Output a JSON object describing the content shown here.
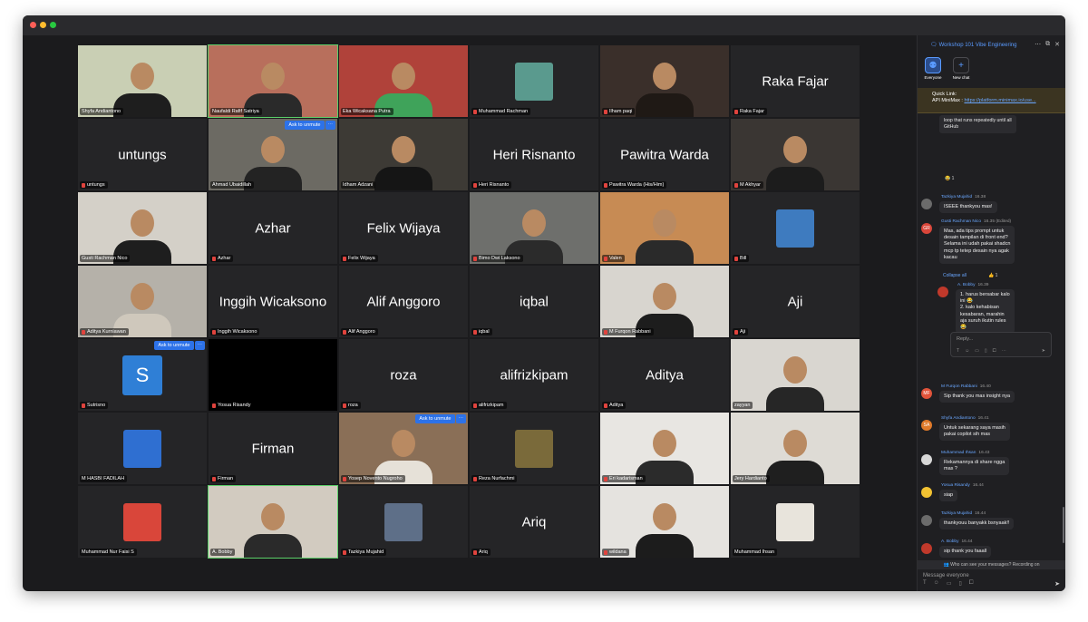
{
  "window": {
    "title": "Workshop 101 Vibe Engineering"
  },
  "chat": {
    "title": "Workshop 101 Vibe Engineering",
    "tabs": [
      {
        "label": "Everyone"
      },
      {
        "label": "New chat"
      }
    ],
    "pinned": {
      "heading": "Quick Link:",
      "text": "API MiniMax : ",
      "link": "https://platform.minimax.io/use..."
    },
    "top_quote": [
      "loop that runs repeatedly until all",
      "GitHub"
    ],
    "top_reaction": "😂 1",
    "messages": [
      {
        "name": "Tazkiya Mujahid",
        "time": "16.38",
        "lines": [
          "ISEEE thankyou mas!"
        ],
        "initials": "",
        "color": "#6b6b6b"
      },
      {
        "name": "Gusti Rachman Nico",
        "time": "16.35 (Edited)",
        "lines": [
          "Mas, ada tips prompt untuk",
          "desain tampilan di front end?",
          "Selama ini udah pakai shadcn",
          "mcp tp tetep desain nya agak",
          "kacau"
        ],
        "initials": "GR",
        "color": "#d9463a"
      },
      {
        "name": "A. Bobby",
        "time": "16.39",
        "lines": [
          "1. harus bersabar kalo",
          "ini 😂",
          "2. kalo kehabisan",
          "kesabaran, marahin",
          "aja suruh ikutin rules",
          "😂"
        ],
        "initials": "",
        "color": "#c0392b"
      },
      {
        "name": "M Furqon Rabbani",
        "time": "16.40",
        "lines": [
          "Sip thank you mas insight nya"
        ],
        "initials": "MF",
        "color": "#e0533a"
      },
      {
        "name": "Shyfa Andiantono",
        "time": "16.41",
        "lines": [
          "Untuk sekarang saya masih",
          "pakai copilot sih mas"
        ],
        "initials": "SA",
        "color": "#e07a2a"
      },
      {
        "name": "Muhammad Ihsan",
        "time": "16.43",
        "lines": [
          "Rekamannya di share ngga",
          "mas ?"
        ],
        "initials": "",
        "color": "#d8d8d8"
      },
      {
        "name": "Yosua Risandy",
        "time": "16.44",
        "lines": [
          "siap"
        ],
        "initials": "",
        "color": "#f2c232"
      },
      {
        "name": "Tazkiya Mujahid",
        "time": "16.44",
        "lines": [
          "thankyouu banyakk bsnyaak!!"
        ],
        "initials": "",
        "color": "#6b6b6b"
      },
      {
        "name": "A. Bobby",
        "time": "16.44",
        "lines": [
          "sip thank you faaall"
        ],
        "initials": "",
        "color": "#c0392b"
      }
    ],
    "collapse_label": "Collapse all",
    "collapse_react": "👍 1",
    "reply_placeholder": "Reply...",
    "notice": "Who can see your messages? Recording on",
    "compose_placeholder": "Message everyone"
  },
  "tiles": [
    {
      "label": "Shyfa Andiantono",
      "bigname": "",
      "kind": "photo",
      "bg": "#c9cfb4",
      "body": "#1e1e1e",
      "muted": false
    },
    {
      "label": "Naufaldi Rafif Satriya",
      "bigname": "",
      "kind": "photo",
      "bg": "#b86f5c",
      "body": "#2a2a2a",
      "muted": false,
      "active": true
    },
    {
      "label": "Eka Wicaksana Putra",
      "bigname": "",
      "kind": "photo",
      "bg": "#b0423a",
      "body": "#3fa35a",
      "muted": false
    },
    {
      "label": "Muhammad Rachman",
      "bigname": "",
      "kind": "avatar",
      "bg": "#252527",
      "avatar": "#5a9a8e",
      "muted": true
    },
    {
      "label": "Ilham paqi",
      "bigname": "",
      "kind": "photo",
      "bg": "#3a2f2a",
      "body": "#1f1915",
      "muted": true
    },
    {
      "label": "Raka Fajar",
      "bigname": "Raka Fajar",
      "kind": "name",
      "muted": true
    },
    {
      "label": "untungs",
      "bigname": "untungs",
      "kind": "name",
      "muted": true
    },
    {
      "label": "Ahmad Ubaidillah",
      "bigname": "",
      "kind": "photo",
      "bg": "#6c6a63",
      "body": "#232323",
      "muted": false,
      "ask": "Ask to unmute"
    },
    {
      "label": "Idham Adzani",
      "bigname": "",
      "kind": "photo",
      "bg": "#3d3a35",
      "body": "#151515",
      "muted": false
    },
    {
      "label": "Heri Risnanto",
      "bigname": "Heri Risnanto",
      "kind": "name",
      "muted": true
    },
    {
      "label": "Pawitra Warda (His/Him)",
      "bigname": "Pawitra Warda",
      "kind": "name",
      "muted": true
    },
    {
      "label": "M Akhyar",
      "bigname": "",
      "kind": "photo",
      "bg": "#3a3633",
      "body": "#1c1c1c",
      "muted": true
    },
    {
      "label": "Gusti Rachman Nico",
      "bigname": "",
      "kind": "photo",
      "bg": "#d4d0c8",
      "body": "#1e1e1e",
      "muted": false
    },
    {
      "label": "Azhar",
      "bigname": "Azhar",
      "kind": "name",
      "muted": true
    },
    {
      "label": "Felix Wijaya",
      "bigname": "Felix Wijaya",
      "kind": "name",
      "muted": true
    },
    {
      "label": "Bimo Dwi Laksono",
      "bigname": "",
      "kind": "photo",
      "bg": "#6e6f6c",
      "body": "#2b2b2b",
      "muted": true
    },
    {
      "label": "Valen",
      "bigname": "",
      "kind": "photo",
      "bg": "#c78b54",
      "body": "#2a2a2a",
      "muted": true
    },
    {
      "label": "Bill",
      "bigname": "",
      "kind": "avatar",
      "bg": "#252527",
      "avatar": "#3e7bbf",
      "muted": true
    },
    {
      "label": "Aditya Kurniawan",
      "bigname": "",
      "kind": "photo",
      "bg": "#b5b1a9",
      "body": "#cfc8bc",
      "muted": true
    },
    {
      "label": "Inggih Wicaksono",
      "bigname": "Inggih Wicaksono",
      "kind": "name",
      "muted": true
    },
    {
      "label": "Alif Anggoro",
      "bigname": "Alif Anggoro",
      "kind": "name",
      "muted": true
    },
    {
      "label": "iqbal",
      "bigname": "iqbal",
      "kind": "name",
      "muted": true
    },
    {
      "label": "M Furqon Rabbani",
      "bigname": "",
      "kind": "photo",
      "bg": "#d8d5cf",
      "body": "#1d1d1d",
      "muted": true
    },
    {
      "label": "Aji",
      "bigname": "Aji",
      "kind": "name",
      "muted": true
    },
    {
      "label": "Sutrisno",
      "bigname": "",
      "kind": "letter",
      "letter": "S",
      "muted": true,
      "ask": "Ask to unmute"
    },
    {
      "label": "Yosua Risandy",
      "bigname": "",
      "kind": "black",
      "muted": true
    },
    {
      "label": "roza",
      "bigname": "roza",
      "kind": "name",
      "muted": true
    },
    {
      "label": "alifrizkipam",
      "bigname": "alifrizkipam",
      "kind": "name",
      "muted": true
    },
    {
      "label": "Aditya",
      "bigname": "Aditya",
      "kind": "name",
      "muted": true
    },
    {
      "label": "zayyan",
      "bigname": "",
      "kind": "photo",
      "bg": "#d9d6d0",
      "body": "#262626",
      "muted": false
    },
    {
      "label": "M HASBI FADILAH",
      "bigname": "",
      "kind": "avatar",
      "bg": "#252527",
      "avatar": "#2f6fd1",
      "muted": false
    },
    {
      "label": "Firman",
      "bigname": "Firman",
      "kind": "name",
      "muted": true
    },
    {
      "label": "Yosep Novento Nugroho",
      "bigname": "",
      "kind": "photo",
      "bg": "#8a6f57",
      "body": "#e6e1d8",
      "muted": true,
      "ask": "Ask to unmute"
    },
    {
      "label": "Reza Nurfachmi",
      "bigname": "",
      "kind": "avatar",
      "bg": "#252527",
      "avatar": "#7a6a3a",
      "muted": true
    },
    {
      "label": "Eri kadarisman",
      "bigname": "",
      "kind": "photo",
      "bg": "#e8e6e2",
      "body": "#2b2b2b",
      "muted": true
    },
    {
      "label": "Jery Hardianto",
      "bigname": "",
      "kind": "photo",
      "bg": "#dedbd5",
      "body": "#1f1f1f",
      "muted": false
    },
    {
      "label": "Muhammad Nur Faisi S",
      "bigname": "",
      "kind": "avatar",
      "bg": "#252527",
      "avatar": "#d9463a",
      "muted": false
    },
    {
      "label": "A. Bobby",
      "bigname": "",
      "kind": "photo",
      "bg": "#d2cbc0",
      "body": "#2a2a2a",
      "muted": false,
      "active": true
    },
    {
      "label": "Tazkiya Mujahid",
      "bigname": "",
      "kind": "avatar",
      "bg": "#252527",
      "avatar": "#5e6f88",
      "muted": true
    },
    {
      "label": "Ariq",
      "bigname": "Ariq",
      "kind": "name",
      "muted": true
    },
    {
      "label": "wildana",
      "bigname": "",
      "kind": "photo",
      "bg": "#e5e3df",
      "body": "#1c1c1c",
      "muted": true
    },
    {
      "label": "Muhammad Ihsan",
      "bigname": "",
      "kind": "avatar",
      "bg": "#252527",
      "avatar": "#e8e4dc",
      "muted": false
    }
  ]
}
